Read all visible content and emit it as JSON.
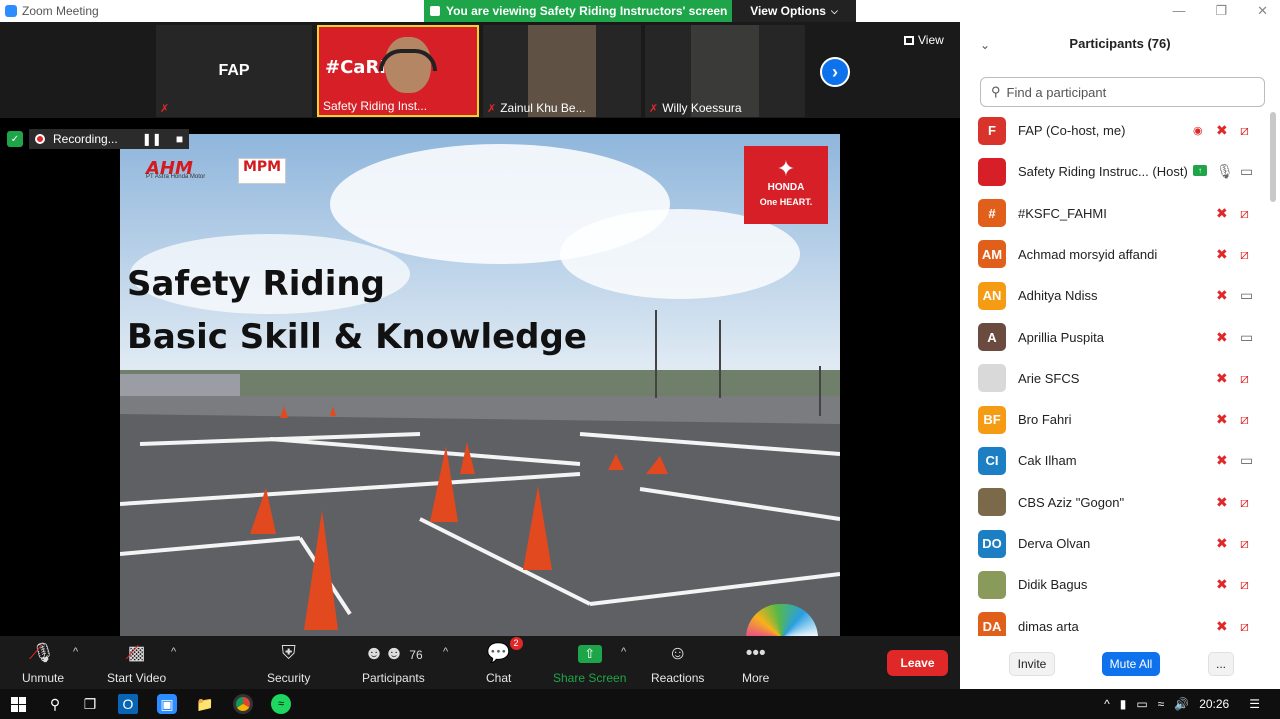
{
  "window": {
    "title": "Zoom Meeting"
  },
  "banner": {
    "viewing": "You are viewing Safety Riding Instructors' screen",
    "view_options": "View Options"
  },
  "thumbnails": [
    {
      "name": "FAP",
      "big_label": "FAP"
    },
    {
      "name": "Safety Riding Inst...",
      "overlay": "#CaRI  an"
    },
    {
      "name": "Zainul Khu Be..."
    },
    {
      "name": "Willy Koessura"
    }
  ],
  "view_label": "View",
  "recording": {
    "label": "Recording..."
  },
  "slide": {
    "ahm": "AHM",
    "ahm_sub": "PT Astra Honda Motor",
    "mpm": "MPM",
    "honda_brand": "HONDA",
    "honda_tagline": "One HEART.",
    "title_line1": "Safety Riding",
    "title_line2": "Basic Skill & Knowledge"
  },
  "toolbar": {
    "unmute": "Unmute",
    "start_video": "Start Video",
    "security": "Security",
    "participants": "Participants",
    "participants_count": "76",
    "chat": "Chat",
    "chat_badge": "2",
    "share_screen": "Share Screen",
    "reactions": "Reactions",
    "more": "More",
    "leave": "Leave"
  },
  "panel": {
    "title": "Participants (76)",
    "search_placeholder": "Find a participant",
    "invite": "Invite",
    "mute_all": "Mute All",
    "more": "..."
  },
  "participants": [
    {
      "initials": "F",
      "name": "FAP (Co-host, me)",
      "color": "#d9342b",
      "mic": "muted",
      "cam": "off"
    },
    {
      "initials": "",
      "name": "Safety Riding Instruc... (Host)",
      "color": "#d61f26",
      "mic": "on",
      "cam": "on"
    },
    {
      "initials": "#",
      "name": "#KSFC_FAHMI",
      "color": "#e0601b",
      "mic": "muted",
      "cam": "off"
    },
    {
      "initials": "AM",
      "name": "Achmad morsyid affandi",
      "color": "#e0601b",
      "mic": "muted",
      "cam": "off"
    },
    {
      "initials": "AN",
      "name": "Adhitya Ndiss",
      "color": "#f59b14",
      "mic": "muted",
      "cam": "on"
    },
    {
      "initials": "A",
      "name": "Aprillia Puspita",
      "color": "#6b4a3f",
      "mic": "muted",
      "cam": "on"
    },
    {
      "initials": "",
      "name": "Arie SFCS",
      "color": "#d9d9d9",
      "mic": "muted",
      "cam": "off"
    },
    {
      "initials": "BF",
      "name": "Bro Fahri",
      "color": "#f59b14",
      "mic": "muted",
      "cam": "off"
    },
    {
      "initials": "CI",
      "name": "Cak Ilham",
      "color": "#1c7fc4",
      "mic": "muted",
      "cam": "on"
    },
    {
      "initials": "",
      "name": "CBS Aziz \"Gogon\"",
      "color": "#7a6a4a",
      "mic": "muted",
      "cam": "off"
    },
    {
      "initials": "DO",
      "name": "Derva Olvan",
      "color": "#1c7fc4",
      "mic": "muted",
      "cam": "off"
    },
    {
      "initials": "",
      "name": "Didik Bagus",
      "color": "#8a9a5b",
      "mic": "muted",
      "cam": "off"
    },
    {
      "initials": "DA",
      "name": "dimas arta",
      "color": "#e0601b",
      "mic": "muted",
      "cam": "off"
    }
  ],
  "taskbar": {
    "time": "20:26"
  },
  "colors": {
    "accent": "#0e72ed",
    "green": "#1ea54a",
    "red": "#e02828"
  }
}
